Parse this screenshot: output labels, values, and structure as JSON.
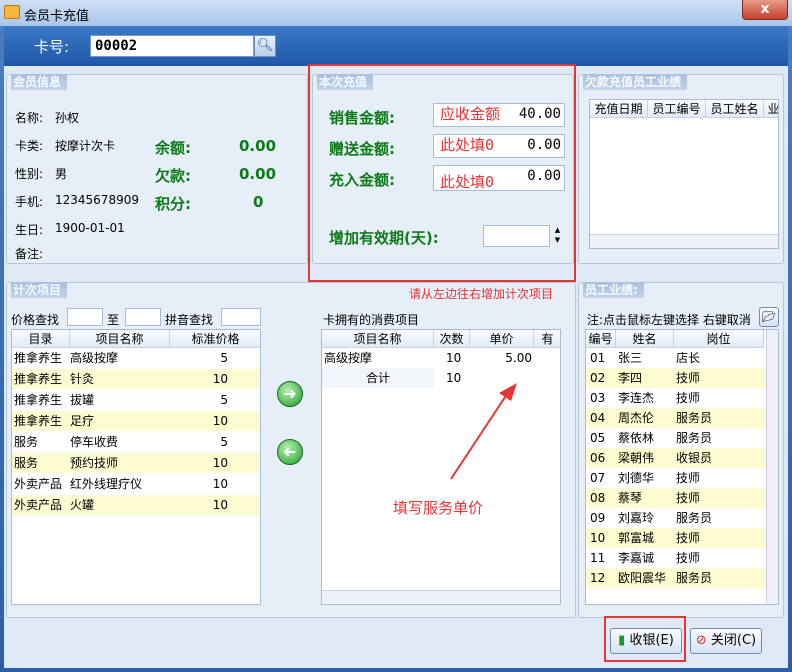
{
  "window": {
    "title": "会员卡充值",
    "close_glyph": "x"
  },
  "card": {
    "label": "卡号:",
    "value": "00002"
  },
  "member": {
    "title": "会员信息",
    "fields": [
      {
        "label": "名称:",
        "value": "孙权"
      },
      {
        "label": "卡类:",
        "value": "按摩计次卡"
      },
      {
        "label": "性别:",
        "value": "男"
      },
      {
        "label": "手机:",
        "value": "12345678909"
      },
      {
        "label": "生日:",
        "value": "1900-01-01"
      },
      {
        "label": "备注:",
        "value": ""
      }
    ],
    "balance_label": "余额:",
    "balance": "0.00",
    "debt_label": "欠款:",
    "debt": "0.00",
    "points_label": "积分:",
    "points": "0"
  },
  "recharge": {
    "title": "本次充值",
    "sale_label": "销售金额:",
    "sale_hint": "应收金额",
    "sale_value": "40.00",
    "gift_label": "赠送金额:",
    "gift_hint": "此处填0",
    "gift_value": "0.00",
    "charge_label": "充入金额:",
    "charge_hint": "此处填0",
    "charge_value": "0.00",
    "validity_label": "增加有效期(天):",
    "validity_value": ""
  },
  "debt_panel": {
    "title": "欠款充值员工业绩",
    "cols": [
      "充值日期",
      "员工编号",
      "员工姓名",
      "业"
    ]
  },
  "items": {
    "title": "计次项目",
    "hint": "请从左边往右增加计次项目",
    "price_search": "价格查找",
    "to": "至",
    "pinyin_search": "拼音查找",
    "cols": [
      "目录",
      "项目名称",
      "标准价格"
    ],
    "rows": [
      [
        "推拿养生",
        "高级按摩",
        "5"
      ],
      [
        "推拿养生",
        "针灸",
        "10"
      ],
      [
        "推拿养生",
        "拔罐",
        "5"
      ],
      [
        "推拿养生",
        "足疗",
        "10"
      ],
      [
        "服务",
        "停车收费",
        "5"
      ],
      [
        "服务",
        "预约技师",
        "10"
      ],
      [
        "外卖产品",
        "红外线理疗仪",
        "10"
      ],
      [
        "外卖产品",
        "火罐",
        "10"
      ]
    ]
  },
  "owned": {
    "title": "卡拥有的消费项目",
    "cols": [
      "项目名称",
      "次数",
      "单价",
      "有"
    ],
    "rows": [
      [
        "高级按摩",
        "10",
        "5.00"
      ]
    ],
    "total_label": "合计",
    "total_count": "10",
    "annotation": "填写服务单价"
  },
  "staff": {
    "title": "员工业绩:",
    "note": "注:点击鼠标左键选择 右键取消",
    "cols": [
      "编号",
      "姓名",
      "岗位"
    ],
    "rows": [
      [
        "01",
        "张三",
        "店长"
      ],
      [
        "02",
        "李四",
        "技师"
      ],
      [
        "03",
        "李连杰",
        "技师"
      ],
      [
        "04",
        "周杰伦",
        "服务员"
      ],
      [
        "05",
        "蔡依林",
        "服务员"
      ],
      [
        "06",
        "梁朝伟",
        "收银员"
      ],
      [
        "07",
        "刘德华",
        "技师"
      ],
      [
        "08",
        "蔡琴",
        "技师"
      ],
      [
        "09",
        "刘嘉玲",
        "服务员"
      ],
      [
        "10",
        "郭富城",
        "技师"
      ],
      [
        "11",
        "李嘉诚",
        "技师"
      ],
      [
        "12",
        "欧阳震华",
        "服务员"
      ]
    ]
  },
  "buttons": {
    "checkout": "收银(E)",
    "close": "关闭(C)"
  },
  "colors": {
    "accent_red": "#e53535",
    "amount_green": "#0e7a1a",
    "alt_row": "#fdfbd0"
  }
}
